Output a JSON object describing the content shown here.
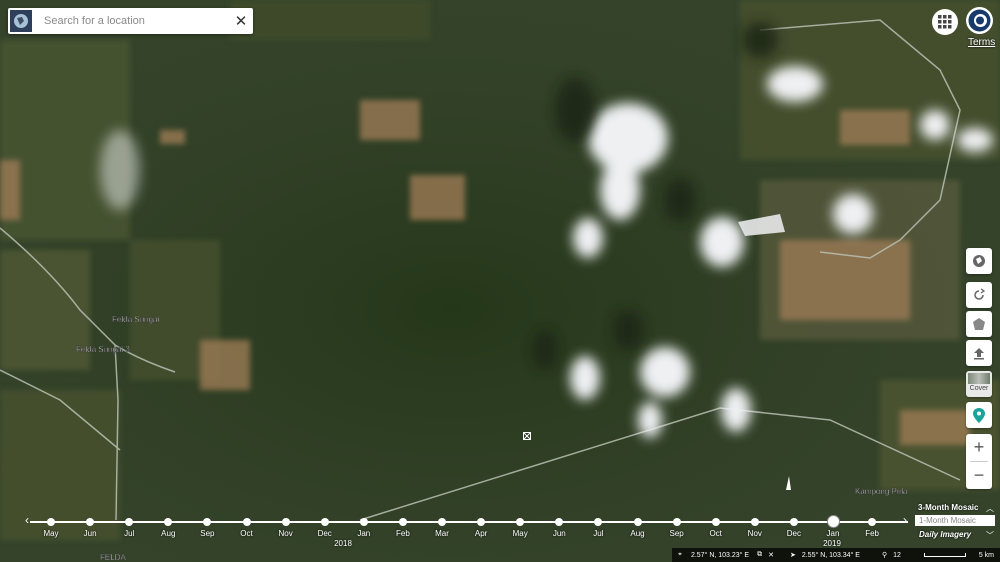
{
  "search": {
    "placeholder": "Search for a location",
    "close_symbol": "✕"
  },
  "header": {
    "terms": "Terms"
  },
  "map": {
    "place_labels": [
      "Felda Sungai",
      "Felda Sungai 3",
      "Kampong Pela",
      "FELDA"
    ],
    "dimension_pm": "ISO",
    "imagery_color": "#2f3f26"
  },
  "tools": {
    "cover_label": "Cover",
    "zoom_in": "+",
    "zoom_out": "−"
  },
  "timeline": {
    "months": [
      "May",
      "Jun",
      "Jul",
      "Aug",
      "Sep",
      "Oct",
      "Nov",
      "Dec",
      "Jan",
      "Feb",
      "Mar",
      "Apr",
      "May",
      "Jun",
      "Jul",
      "Aug",
      "Sep",
      "Oct",
      "Nov",
      "Dec",
      "Jan",
      "Feb"
    ],
    "years": [
      "2018",
      "2019"
    ],
    "selected_index": 20
  },
  "mosaic": {
    "three_month": "3-Month Mosaic",
    "one_month": "1-Month Mosaic",
    "daily": "Daily Imagery"
  },
  "status": {
    "center_coords": "2.57° N, 103.23° E",
    "cursor_coords": "2.55° N, 103.34° E",
    "zoom": "12",
    "scale": "5 km"
  },
  "colors": {
    "accent": "#1aa39a",
    "logo": "#173a6a"
  }
}
